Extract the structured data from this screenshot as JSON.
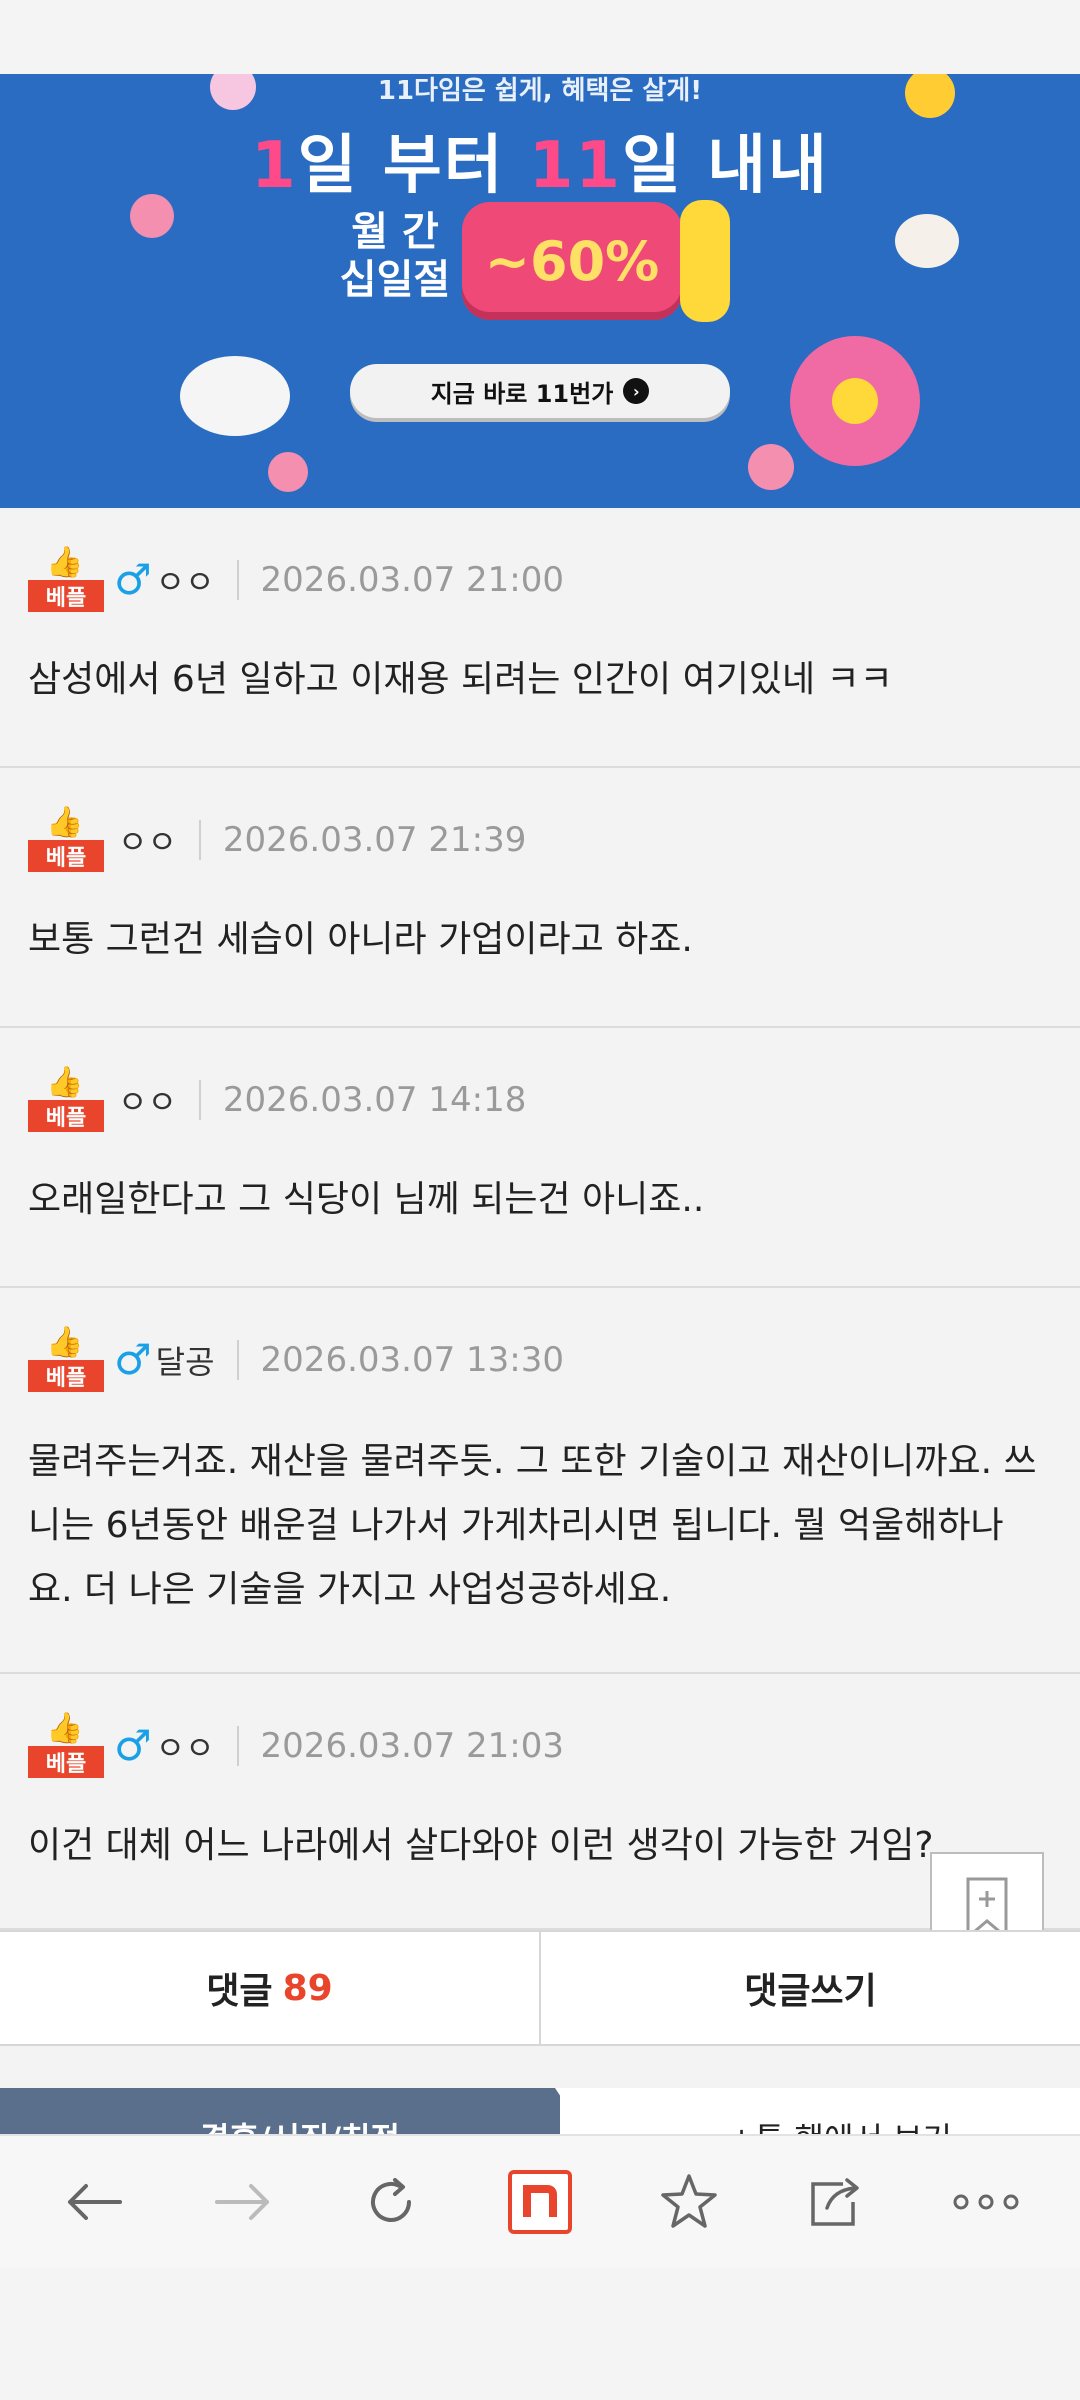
{
  "banner": {
    "top_text": "11다임은 쉽게, 혜택은 살게!",
    "headline_prefix": "1",
    "headline_mid": "일 부터 ",
    "headline_num": "11",
    "headline_suffix": "일 내내",
    "sub_line1": "월 간",
    "sub_line2": "십일절",
    "discount": "~60%",
    "cta_label": "지금 바로 11번가",
    "cta_icon": "chevron-right-icon"
  },
  "comments": [
    {
      "badge": "베플",
      "gender": "♂",
      "nick": "ㅇㅇ",
      "date": "2026.03.07 21:00",
      "body": "삼성에서 6년 일하고 이재용 되려는 인간이 여기있네 ㅋㅋ"
    },
    {
      "badge": "베플",
      "gender": "",
      "nick": "ㅇㅇ",
      "date": "2026.03.07 21:39",
      "body": "보통 그런건 세습이 아니라 가업이라고 하죠."
    },
    {
      "badge": "베플",
      "gender": "",
      "nick": "ㅇㅇ",
      "date": "2026.03.07 14:18",
      "body": "오래일한다고 그 식당이 님께 되는건 아니죠.."
    },
    {
      "badge": "베플",
      "gender": "♂",
      "nick": "달공",
      "date": "2026.03.07 13:30",
      "body": "물려주는거죠. 재산을 물려주듯. 그 또한 기술이고 재산이니까요. 쓰니는 6년동안 배운걸 나가서 가게차리시면 됩니다. 뭘 억울해하나요. 더 나은 기술을 가지고 사업성공하세요."
    },
    {
      "badge": "베플",
      "gender": "♂",
      "nick": "ㅇㅇ",
      "date": "2026.03.07 21:03",
      "body": "이건 대체 어느 나라에서 살다와야 이런 생각이 가능한 거임?"
    }
  ],
  "actions": {
    "comments_label": "댓글",
    "comments_count": "89",
    "write_label": "댓글쓰기"
  },
  "tabs": {
    "active": "결혼/시집/친정",
    "other": "+톡 핸에서 보기"
  },
  "browser": {
    "icons": [
      "back-arrow-icon",
      "forward-arrow-icon",
      "refresh-icon",
      "naver-home-icon",
      "star-icon",
      "share-icon",
      "more-icon"
    ],
    "home_letter": "n",
    "accent": "#e8452c"
  }
}
